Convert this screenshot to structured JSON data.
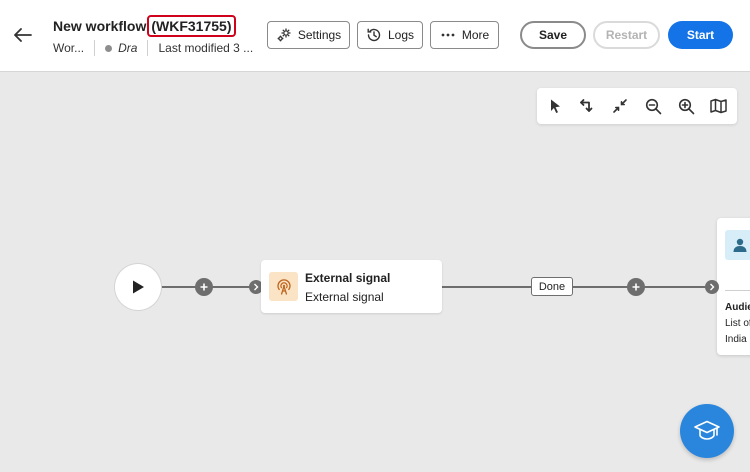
{
  "header": {
    "title": "New workflow",
    "workflow_id": "(WKF31755)",
    "breadcrumb": "Wor...",
    "status": "Dra",
    "last_modified": "Last modified 3 ..."
  },
  "toolbar": {
    "settings_label": "Settings",
    "logs_label": "Logs",
    "more_label": "More",
    "save_label": "Save",
    "restart_label": "Restart",
    "start_label": "Start"
  },
  "canvas_tools": [
    "select-icon",
    "reroute-icon",
    "fit-icon",
    "zoom-out-icon",
    "zoom-in-icon",
    "map-icon"
  ],
  "canvas": {
    "external_signal": {
      "title": "External signal",
      "subtitle": "External signal"
    },
    "transition_label": "Done",
    "audience": {
      "title": "Audie",
      "line1": "List of",
      "line2": "India ("
    }
  },
  "colors": {
    "accent": "#1473e6",
    "highlight": "#d0021b",
    "signal_bg": "#fbe3c6",
    "audience_bg": "#d7eef8",
    "help_fab": "#2a86dd"
  }
}
